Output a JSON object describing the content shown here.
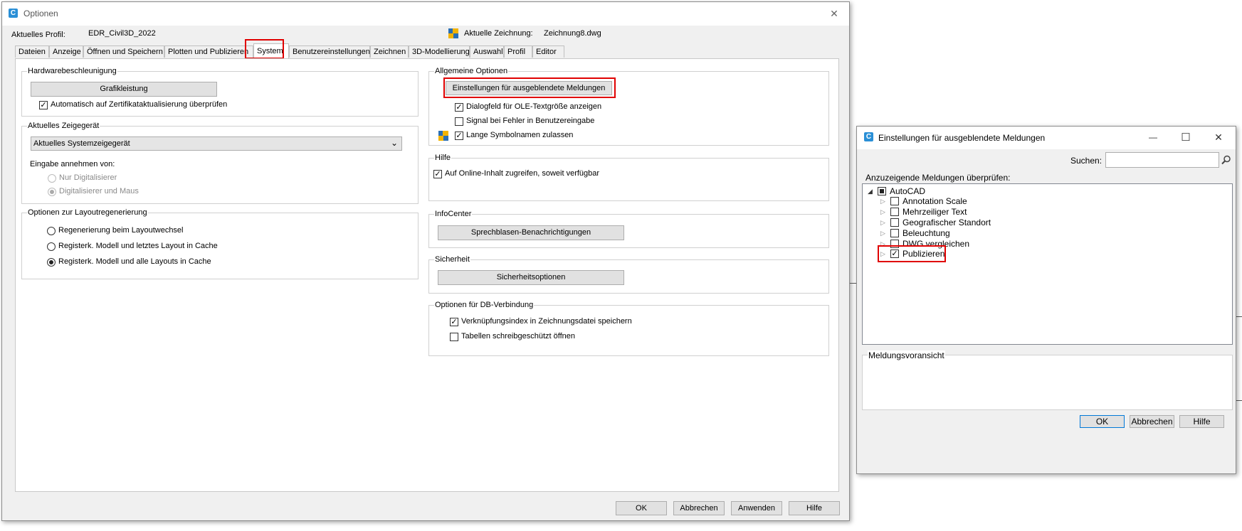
{
  "main_dialog": {
    "title": "Optionen",
    "close_glyph": "✕",
    "profile_label": "Aktuelles Profil:",
    "profile_value": "EDR_Civil3D_2022",
    "drawing_label": "Aktuelle Zeichnung:",
    "drawing_value": "Zeichnung8.dwg",
    "tabs": [
      {
        "label": "Dateien"
      },
      {
        "label": "Anzeige"
      },
      {
        "label": "Öffnen und Speichern"
      },
      {
        "label": "Plotten und Publizieren"
      },
      {
        "label": "System",
        "active": true
      },
      {
        "label": "Benutzereinstellungen"
      },
      {
        "label": "Zeichnen"
      },
      {
        "label": "3D-Modellierung"
      },
      {
        "label": "Auswahl"
      },
      {
        "label": "Profil"
      },
      {
        "label": "Editor"
      }
    ],
    "hardware": {
      "title": "Hardwarebeschleunigung",
      "button": "Grafikleistung",
      "checkbox_label": "Automatisch auf Zertifikataktualisierung überprüfen",
      "checked": true
    },
    "pointer": {
      "title": "Aktuelles Zeigegerät",
      "select_value": "Aktuelles Systemzeigegerät",
      "input_label": "Eingabe annehmen von:",
      "options": [
        "Nur Digitalisierer",
        "Digitalisierer und Maus"
      ],
      "selected_index": 1
    },
    "layout_regen": {
      "title": "Optionen zur Layoutregenerierung",
      "options": [
        "Regenerierung beim Layoutwechsel",
        "Registerk. Modell und letztes Layout in Cache",
        "Registerk. Modell und alle Layouts in Cache"
      ],
      "selected_index": 2
    },
    "general": {
      "title": "Allgemeine Optionen",
      "button": "Einstellungen für ausgeblendete Meldungen",
      "checkboxes": [
        {
          "label": "Dialogfeld für OLE-Textgröße anzeigen",
          "checked": true
        },
        {
          "label": "Signal bei Fehler in Benutzereingabe",
          "checked": false
        },
        {
          "label": "Lange Symbolnamen zulassen",
          "checked": true
        }
      ]
    },
    "help": {
      "title": "Hilfe",
      "checkbox_label": "Auf Online-Inhalt zugreifen, soweit verfügbar",
      "checked": true
    },
    "infocenter": {
      "title": "InfoCenter",
      "button": "Sprechblasen-Benachrichtigungen"
    },
    "security": {
      "title": "Sicherheit",
      "button": "Sicherheitsoptionen"
    },
    "db": {
      "title": "Optionen für DB-Verbindung",
      "checkboxes": [
        {
          "label": "Verknüpfungsindex in Zeichnungsdatei speichern",
          "checked": true
        },
        {
          "label": "Tabellen schreibgeschützt öffnen",
          "checked": false
        }
      ]
    },
    "buttons": {
      "ok": "OK",
      "cancel": "Abbrechen",
      "apply": "Anwenden",
      "help": "Hilfe"
    }
  },
  "hidden_messages_dialog": {
    "title": "Einstellungen für ausgeblendete Meldungen",
    "minimize_glyph": "—",
    "maximize_glyph": "☐",
    "close_glyph": "✕",
    "search_label": "Suchen:",
    "search_value": "",
    "list_label": "Anzuzeigende Meldungen überprüfen:",
    "tree": {
      "root": "AutoCAD",
      "items": [
        {
          "label": "Annotation Scale",
          "checked": false
        },
        {
          "label": "Mehrzeiliger Text",
          "checked": false
        },
        {
          "label": "Geografischer Standort",
          "checked": false
        },
        {
          "label": "Beleuchtung",
          "checked": false
        },
        {
          "label": "DWG vergleichen",
          "checked": false
        },
        {
          "label": "Publizieren",
          "checked": true
        }
      ]
    },
    "preview_label": "Meldungsvoransicht",
    "buttons": {
      "ok": "OK",
      "cancel": "Abbrechen",
      "help": "Hilfe"
    }
  },
  "colors": {
    "highlight": "#e00000",
    "accent": "#2a8fd6"
  }
}
